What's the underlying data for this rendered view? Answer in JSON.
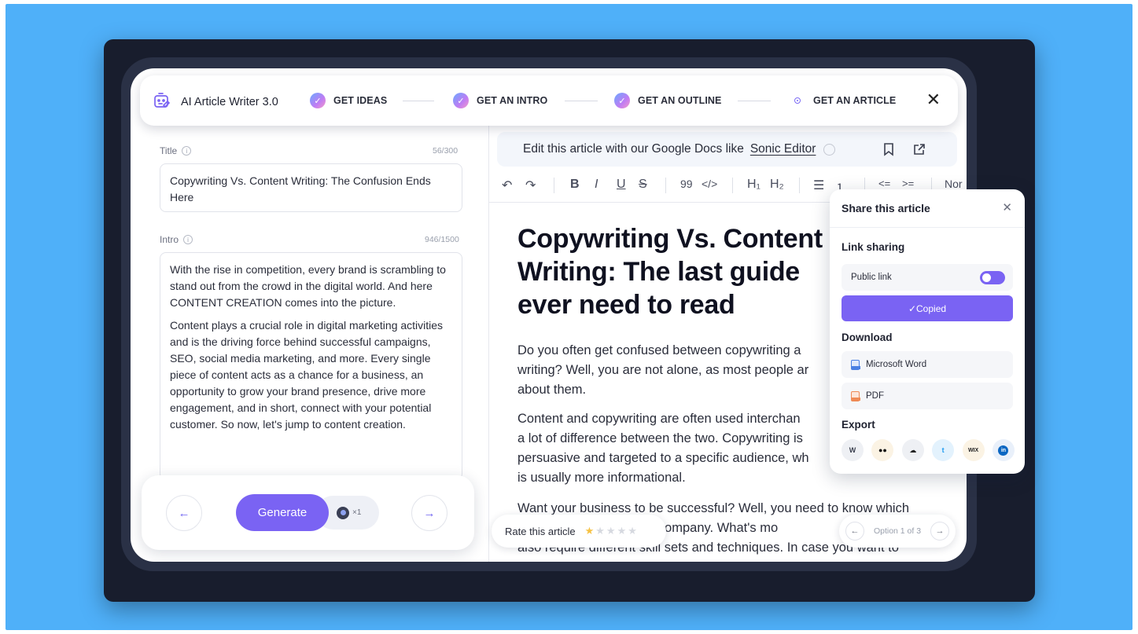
{
  "app": {
    "title": "AI Article Writer 3.0"
  },
  "steps": [
    {
      "label": "GET IDEAS",
      "state": "done"
    },
    {
      "label": "GET AN INTRO",
      "state": "done"
    },
    {
      "label": "GET AN OUTLINE",
      "state": "done"
    },
    {
      "label": "GET AN ARTICLE",
      "state": "current"
    }
  ],
  "left": {
    "title_label": "Title",
    "title_count": "56/300",
    "title_value": "Copywriting Vs. Content Writing: The Confusion Ends Here",
    "intro_label": "Intro",
    "intro_count": "946/1500",
    "intro_paragraphs": [
      "With the rise in competition, every brand is scrambling to stand out from the crowd in the digital world. And here CONTENT CREATION comes into the picture.",
      "Content plays a crucial role in digital marketing activities and is the driving force behind successful campaigns, SEO, social media marketing, and more. Every single piece of content acts as a chance for a business, an opportunity to grow your brand presence, drive more engagement, and in short, connect with your potential customer. So now, let's jump to content creation."
    ],
    "generate_label": "Generate",
    "credit_label": "×1"
  },
  "editor": {
    "banner_text": "Edit this article with our Google Docs like",
    "banner_link": "Sonic Editor",
    "toolbar": {
      "undo": "↶",
      "redo": "↷",
      "bold": "B",
      "italic": "I",
      "underline": "U",
      "strike": "S",
      "quote": "99",
      "code": "</>",
      "h1": "H₁",
      "h2": "H₂",
      "bullets": "☰",
      "numbers": "⒈",
      "outdent": "<=",
      "indent": ">=",
      "style": "Nor"
    },
    "article_title": "Copywriting Vs. Content\nWriting: The last guide\never need to read",
    "paragraphs": [
      "Do you often get confused between copywriting a\nwriting? Well, you are not alone, as most people ar\nabout them.",
      "Content and copywriting are often used interchan\na lot of difference between the two. Copywriting is\npersuasive and targeted to a specific audience, wh\nis usually more informational.",
      "Want your business to be successful? Well, you need to know which\n                              n the company. What's mo\nalso require different skill sets and techniques. In case you want to"
    ],
    "rate_label": "Rate this article",
    "rating": 1,
    "rating_max": 5,
    "option_label": "Option 1 of 3"
  },
  "share": {
    "title": "Share this article",
    "link_sharing": "Link sharing",
    "public_link": "Public link",
    "public_link_on": true,
    "copied_label": "✓Copied",
    "download": "Download",
    "word": "Microsoft Word",
    "pdf": "PDF",
    "export": "Export",
    "export_targets": [
      "wordpress",
      "medium",
      "ghost",
      "twitter",
      "wix",
      "linkedin"
    ]
  },
  "colors": {
    "accent": "#7a63f3",
    "background": "#4fb0f9",
    "frame": "#181d2d"
  }
}
